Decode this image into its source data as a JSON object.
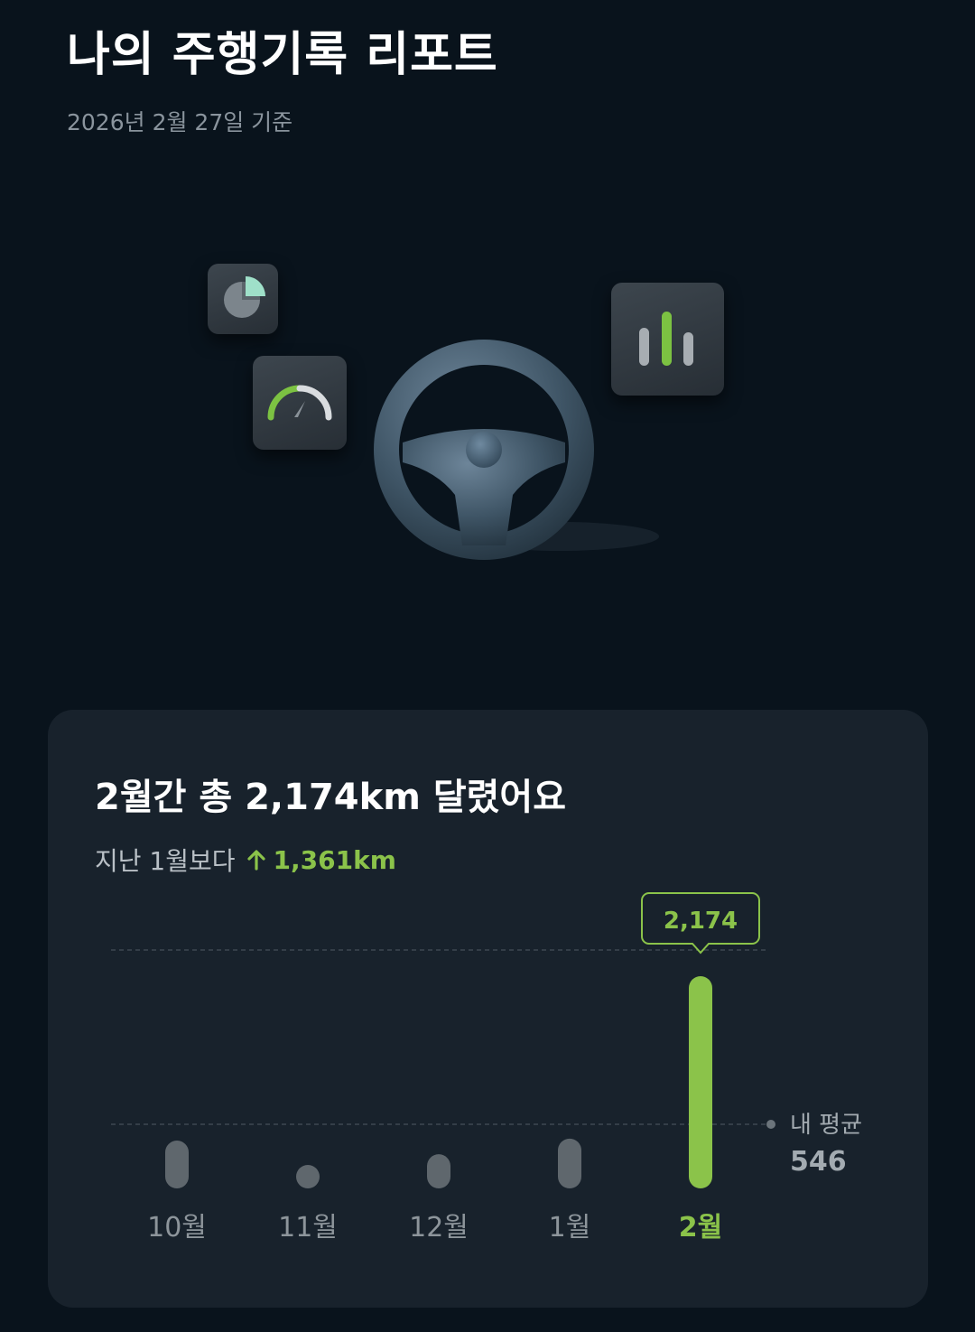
{
  "header": {
    "title": "나의 주행기록 리포트",
    "date": "2026년 2월 27일 기준"
  },
  "hero": {
    "icons": [
      "pie-chart-icon",
      "speedometer-icon",
      "bar-chart-icon",
      "steering-wheel-icon"
    ]
  },
  "summary": {
    "title": "2월간 총 2,174km 달렸어요",
    "compare_label": "지난 1월보다",
    "compare_value": "1,361km",
    "compare_direction": "up"
  },
  "colors": {
    "accent": "#8bc34a",
    "bar_inactive": "#5f676d",
    "background": "#09131c",
    "card": "#18222c"
  },
  "chart_data": {
    "type": "bar",
    "categories": [
      "10월",
      "11월",
      "12월",
      "1월",
      "2월"
    ],
    "values": [
      490,
      60,
      350,
      510,
      2174
    ],
    "highlight_index": 4,
    "highlight_label": "2,174",
    "average": {
      "label": "내 평균",
      "value": 546,
      "value_text": "546"
    },
    "ylim": [
      0,
      2174
    ]
  }
}
